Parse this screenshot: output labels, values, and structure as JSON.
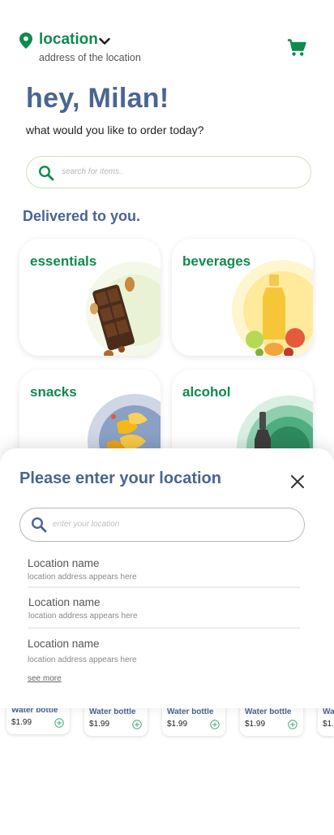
{
  "header": {
    "location_title": "location",
    "location_subtitle": "address of the location"
  },
  "greeting": {
    "title": "hey, Milan!",
    "subtitle": "what would you like to order today?"
  },
  "search": {
    "placeholder": "search for items.."
  },
  "delivered": {
    "title": "Delivered to you."
  },
  "categories": [
    {
      "label": "essentials",
      "art": "chocolate-bar-image"
    },
    {
      "label": "beverages",
      "art": "juice-fruits-image"
    },
    {
      "label": "snacks",
      "art": "chips-image"
    },
    {
      "label": "alcohol",
      "art": "beer-bottle-image"
    }
  ],
  "products": [
    {
      "name": "Water bottle",
      "price": "$1.99"
    },
    {
      "name": "Water bottle",
      "price": "$1.99"
    },
    {
      "name": "Water bottle",
      "price": "$1.99"
    },
    {
      "name": "Water bottle",
      "price": "$1.99"
    },
    {
      "name": "Wa",
      "price": "$1."
    }
  ],
  "location_sheet": {
    "title": "Please enter your location",
    "search_placeholder": "enter your location",
    "items": [
      {
        "name": "Location name",
        "address": "location address appears here"
      },
      {
        "name": "Location name",
        "address": "location address appears here"
      },
      {
        "name": "Location name",
        "address": "location address appears here"
      }
    ],
    "see_more": "see more"
  },
  "colors": {
    "brand_green": "#0f8a4f",
    "heading_blue": "#4a6591"
  },
  "icons": [
    "map-pin-icon",
    "chevron-down-icon",
    "cart-icon",
    "search-icon",
    "close-icon",
    "add-circle-icon"
  ]
}
